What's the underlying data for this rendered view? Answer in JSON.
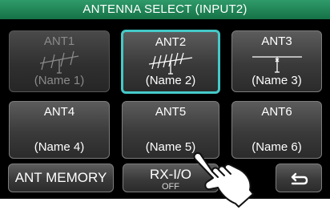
{
  "title": "ANTENNA SELECT (INPUT2)",
  "antennas": [
    {
      "label": "ANT1",
      "name": "(Name 1)",
      "icon": "yagi-antenna-icon"
    },
    {
      "label": "ANT2",
      "name": "(Name 2)",
      "icon": "log-periodic-antenna-icon"
    },
    {
      "label": "ANT3",
      "name": "(Name 3)",
      "icon": "dipole-antenna-icon"
    },
    {
      "label": "ANT4",
      "name": "(Name 4)"
    },
    {
      "label": "ANT5",
      "name": "(Name 5)"
    },
    {
      "label": "ANT6",
      "name": "(Name 6)"
    }
  ],
  "footer": {
    "ant_memory": "ANT MEMORY",
    "rx_io_label": "RX-I/O",
    "rx_io_value": "OFF",
    "return_icon": "return-arrow-icon"
  },
  "colors": {
    "title_bar": "#1f8a57",
    "selected_border": "#45c9c9",
    "screen_bg": "#000000"
  }
}
